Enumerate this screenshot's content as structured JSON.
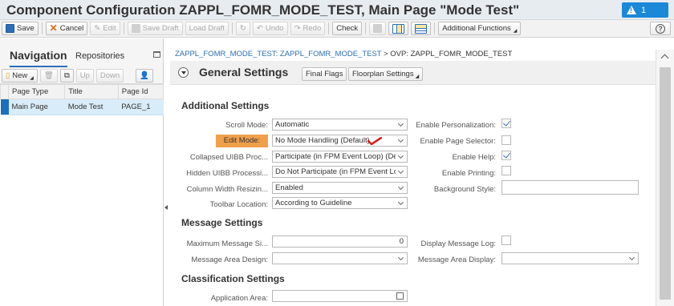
{
  "title": "Component Configuration ZAPPL_FOMR_MODE_TEST, Main Page \"Mode Test\"",
  "alert": {
    "count": "1"
  },
  "toolbar": {
    "save": "Save",
    "cancel": "Cancel",
    "edit": "Edit",
    "save_draft": "Save Draft",
    "load_draft": "Load Draft",
    "undo": "Undo",
    "redo": "Redo",
    "check": "Check",
    "additional_functions": "Additional Functions"
  },
  "nav": {
    "tab_navigation": "Navigation",
    "tab_repositories": "Repositories",
    "tools": {
      "new": "New",
      "up": "Up",
      "down": "Down"
    },
    "columns": [
      "Page Type",
      "Title",
      "Page Id"
    ],
    "rows": [
      {
        "page_type": "Main Page",
        "title": "Mode Test",
        "page_id": "PAGE_1"
      }
    ]
  },
  "breadcrumb": {
    "link": "ZAPPL_FOMR_MODE_TEST: ZAPPL_FOMR_MODE_TEST",
    "separator": " > ",
    "current": "OVP: ZAPPL_FOMR_MODE_TEST"
  },
  "section": {
    "title": "General Settings",
    "final_flags": "Final Flags",
    "floorplan_settings": "Floorplan Settings"
  },
  "additional": {
    "title": "Additional Settings",
    "scroll_mode_label": "Scroll Mode:",
    "scroll_mode_value": "Automatic",
    "edit_mode_label": "Edit Mode:",
    "edit_mode_value": "No Mode Handling (Default)",
    "collapsed_label": "Collapsed UIBB Proc...",
    "collapsed_value": "Participate (in FPM Event Loop) (Defau",
    "hidden_label": "Hidden UIBB Processi...",
    "hidden_value": "Do Not Participate (in FPM Event Loop",
    "colwidth_label": "Column Width Resizin...",
    "colwidth_value": "Enabled",
    "toolbar_loc_label": "Toolbar Location:",
    "toolbar_loc_value": "According to Guideline",
    "personalization_label": "Enable Personalization:",
    "personalization_checked": true,
    "page_selector_label": "Enable Page Selector:",
    "page_selector_checked": false,
    "help_label": "Enable Help:",
    "help_checked": true,
    "printing_label": "Enable Printing:",
    "printing_checked": false,
    "background_label": "Background Style:",
    "background_value": ""
  },
  "message": {
    "title": "Message Settings",
    "max_label": "Maximum Message Si...",
    "max_value": "0",
    "design_label": "Message Area Design:",
    "design_value": "",
    "display_log_label": "Display Message Log:",
    "display_log_checked": false,
    "area_display_label": "Message Area Display:",
    "area_display_value": ""
  },
  "classification": {
    "title": "Classification Settings",
    "app_area_label": "Application Area:",
    "app_area_value": ""
  }
}
